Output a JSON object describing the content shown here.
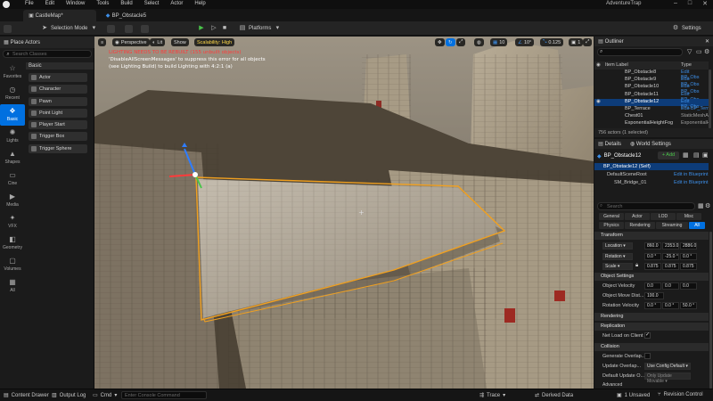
{
  "app": {
    "menu": [
      "File",
      "Edit",
      "Window",
      "Tools",
      "Build",
      "Select",
      "Actor",
      "Help"
    ],
    "project_name": "AdventureTrap",
    "tabs": [
      "CastleMap*",
      "BP_Obstacle5"
    ]
  },
  "toolbar": {
    "selection_mode": "Selection Mode",
    "platforms": "Platforms",
    "settings": "Settings"
  },
  "place_actors": {
    "title": "Place Actors",
    "search_placeholder": "Search Classes",
    "categories": [
      "Favorites",
      "Recent",
      "Basic",
      "Lights",
      "Shapes",
      "Cine",
      "Media",
      "VFX",
      "Geometry",
      "Volumes",
      "All"
    ],
    "selected_category": "Basic",
    "section": "Basic",
    "items": [
      "Actor",
      "Character",
      "Pawn",
      "Point Light",
      "Player Start",
      "Trigger Box",
      "Trigger Sphere"
    ]
  },
  "viewport": {
    "perspective": "Perspective",
    "lit": "Lit",
    "show": "Show",
    "scalability": "Scalability: High",
    "warnings": [
      "LIGHTING NEEDS TO BE REBUILT (155 unbuilt objects)",
      "'DisableAllScreenMessages' to suppress this error for all objects",
      "(see Lighting Build) to build Lighting with 4:2:1 (a)"
    ],
    "grid_snap": "10",
    "rot_snap": "10°",
    "scale_snap": "0.125",
    "cam_speed": "1",
    "colors": {
      "warning": "#ff3b3b",
      "selection": "#f0a020"
    }
  },
  "outliner": {
    "title": "Outliner",
    "col_label": "Item Label",
    "col_type": "Type",
    "rows": [
      {
        "name": "BP_Obstacle8",
        "type": "Edit BP_Obs"
      },
      {
        "name": "BP_Obstacle9",
        "type": "Edit BP_Obs"
      },
      {
        "name": "BP_Obstacle10",
        "type": "Edit BP_Obs"
      },
      {
        "name": "BP_Obstacle11",
        "type": "Edit BP_Obs"
      },
      {
        "name": "BP_Obstacle12",
        "type": "Edit BP_Obs"
      },
      {
        "name": "BP_Terrace",
        "type": "Edit BP_Terr"
      },
      {
        "name": "Chest01",
        "type": "StaticMeshA"
      },
      {
        "name": "ExponentialHeightFog",
        "type": "ExponentialH"
      }
    ],
    "selected_index": 4,
    "count": "756 actors (1 selected)"
  },
  "details": {
    "title": "Details",
    "world_settings": "World Settings",
    "actor_name": "BP_Obstacle12",
    "add": "+ Add",
    "self_label": "BP_Obstacle12 (Self)",
    "scene_root": "DefaultSceneRoot",
    "scene_root_link": "Edit in Blueprint",
    "mesh": "SM_Bridge_01",
    "mesh_link": "Edit in Blueprint",
    "search_placeholder": "Search",
    "filter_tabs_row1": [
      "General",
      "Actor",
      "LOD",
      "Misc"
    ],
    "filter_tabs_row2": [
      "Physics",
      "Rendering",
      "Streaming",
      "All"
    ],
    "filter_selected": "All",
    "transform_section": "Transform",
    "location_label": "Location",
    "location": [
      "860.0",
      "2353.0",
      "2886.0"
    ],
    "rotation_label": "Rotation",
    "rotation": [
      "0.0 °",
      "-25.0 °",
      "0.0 °"
    ],
    "scale_label": "Scale",
    "scale": [
      "0.875",
      "0.875",
      "0.875"
    ],
    "object_settings": "Object Settings",
    "object_velocity_label": "Object Velocity",
    "object_velocity": [
      "0.0",
      "0.0",
      "0.0"
    ],
    "move_dist_label": "Object Move Dist...",
    "move_dist": "100.0",
    "rotation_velocity_label": "Rotation Velocity",
    "rotation_velocity": [
      "0.0 °",
      "0.0 °",
      "50.0 °"
    ],
    "rendering_section": "Rendering",
    "replication_section": "Replication",
    "net_load_label": "Net Load on Client",
    "collision_section": "Collision",
    "gen_overlap_label": "Generate Overlap...",
    "update_overlap_label": "Update Overlap...",
    "update_overlap_value": "Use Config Default",
    "default_update_label": "Default Update O...",
    "default_update_value": "Only Update Movable",
    "advanced": "Advanced"
  },
  "statusbar": {
    "content_drawer": "Content Drawer",
    "output_log": "Output Log",
    "cmd": "Cmd",
    "cmd_placeholder": "Enter Console Command",
    "trace": "Trace",
    "derived_data": "Derived Data",
    "unsaved": "1 Unsaved",
    "revision_control": "Revision Control"
  }
}
